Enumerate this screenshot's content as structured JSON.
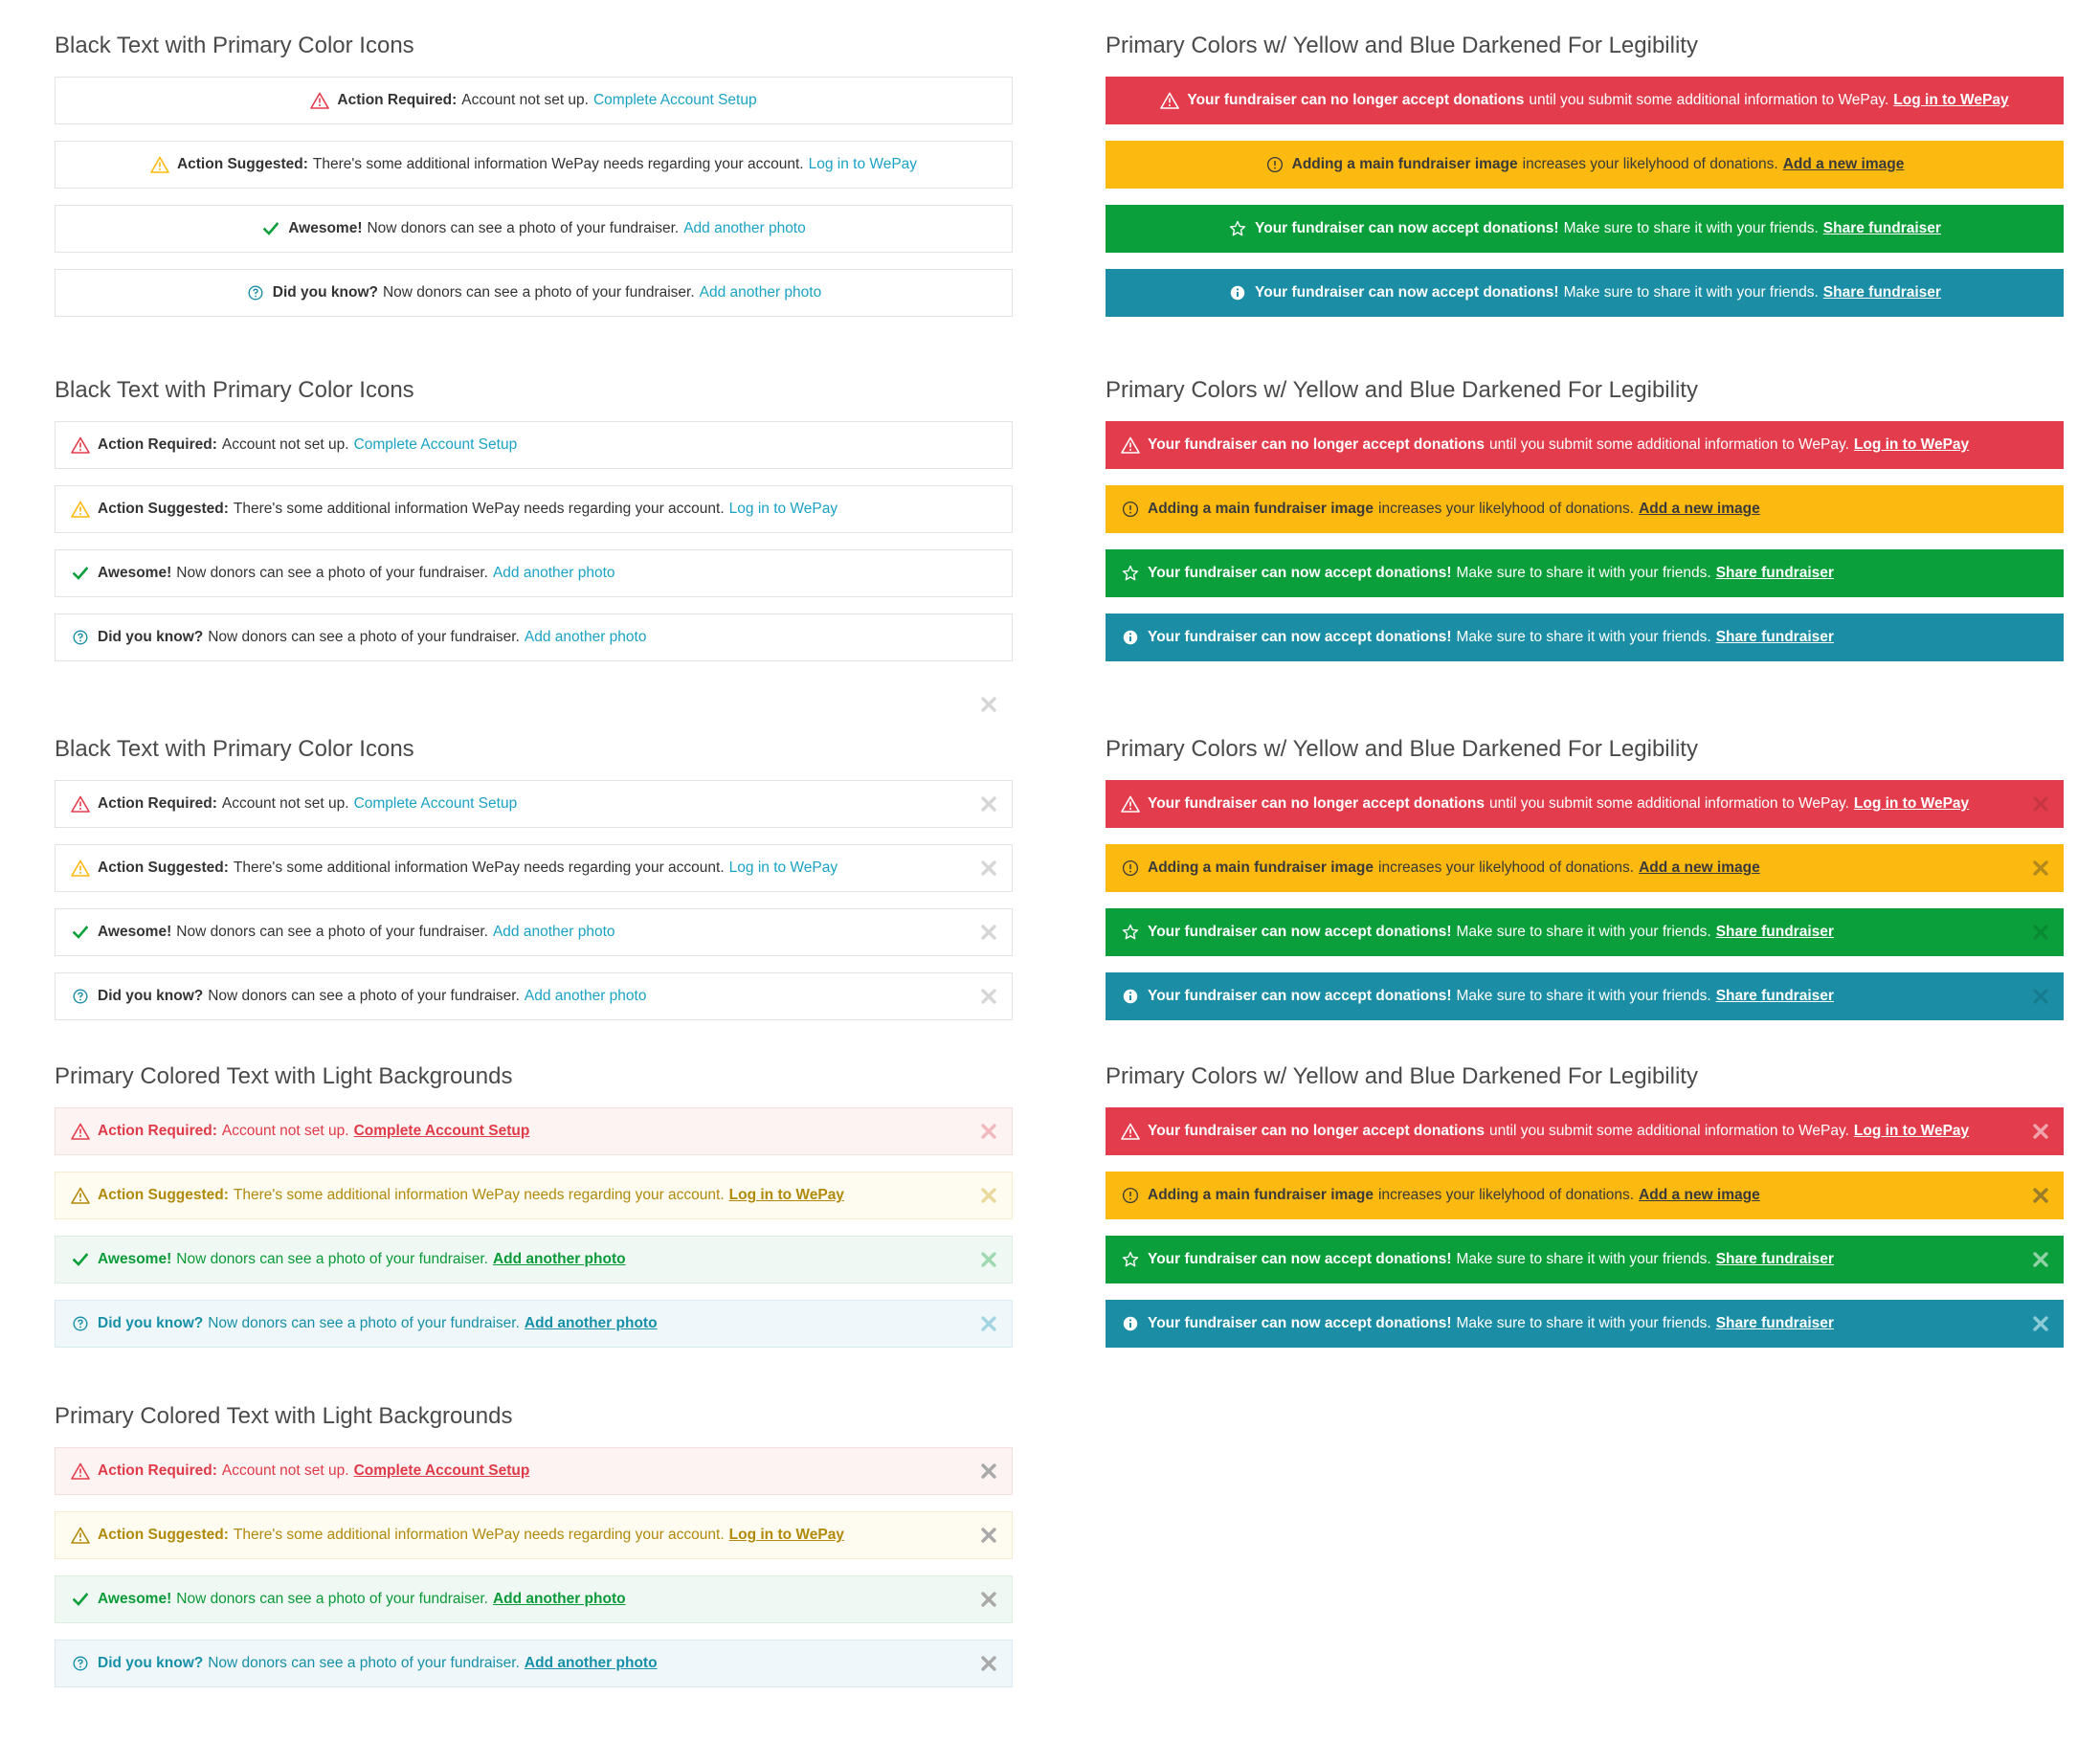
{
  "colors": {
    "red": "#e33d4d",
    "yellow": "#fcb90f",
    "green": "#0a9f3a",
    "blue": "#1b8ea6",
    "link": "#1aa3c4"
  },
  "left_sections": [
    {
      "title": "Black Text with Primary Color Icons",
      "alerts": [
        {
          "icon": "warning-triangle-icon",
          "bold": "Action Required:",
          "msg": "Account not set up.",
          "link": "Complete Account Setup"
        },
        {
          "icon": "warning-triangle-icon",
          "bold": "Action Suggested:",
          "msg": "There's some additional information WePay needs regarding your account.",
          "link": "Log in to WePay"
        },
        {
          "icon": "checkmark-icon",
          "bold": "Awesome!",
          "msg": "Now donors can see a photo of your fundraiser.",
          "link": "Add another photo"
        },
        {
          "icon": "question-circle-icon",
          "bold": "Did you know?",
          "msg": "Now donors can see a photo of your fundraiser.",
          "link": "Add another photo"
        }
      ]
    },
    {
      "title": "Black Text with Primary Color Icons",
      "alerts": [
        {
          "icon": "warning-triangle-icon",
          "bold": "Action Required:",
          "msg": "Account not set up.",
          "link": "Complete Account Setup"
        },
        {
          "icon": "warning-triangle-icon",
          "bold": "Action Suggested:",
          "msg": "There's some additional information WePay needs regarding your account.",
          "link": "Log in to WePay"
        },
        {
          "icon": "checkmark-icon",
          "bold": "Awesome!",
          "msg": "Now donors can see a photo of your fundraiser.",
          "link": "Add another photo"
        },
        {
          "icon": "question-circle-icon",
          "bold": "Did you know?",
          "msg": "Now donors can see a photo of your fundraiser.",
          "link": "Add another photo"
        }
      ]
    },
    {
      "title": "Black Text with Primary Color Icons",
      "alerts": [
        {
          "icon": "warning-triangle-icon",
          "bold": "Action Required:",
          "msg": "Account not set up.",
          "link": "Complete Account Setup"
        },
        {
          "icon": "warning-triangle-icon",
          "bold": "Action Suggested:",
          "msg": "There's some additional information WePay needs regarding your account.",
          "link": "Log in to WePay"
        },
        {
          "icon": "checkmark-icon",
          "bold": "Awesome!",
          "msg": "Now donors can see a photo of your fundraiser.",
          "link": "Add another photo"
        },
        {
          "icon": "question-circle-icon",
          "bold": "Did you know?",
          "msg": "Now donors can see a photo of your fundraiser.",
          "link": "Add another photo"
        }
      ]
    },
    {
      "title": "Primary Colored Text with Light Backgrounds",
      "alerts": [
        {
          "icon": "warning-triangle-icon",
          "bold": "Action Required:",
          "msg": "Account not set up.",
          "link": "Complete Account Setup"
        },
        {
          "icon": "warning-triangle-icon",
          "bold": "Action Suggested:",
          "msg": "There's some additional information WePay needs regarding your account.",
          "link": "Log in to WePay"
        },
        {
          "icon": "checkmark-icon",
          "bold": "Awesome!",
          "msg": "Now donors can see a photo of your fundraiser.",
          "link": "Add another photo"
        },
        {
          "icon": "question-circle-icon",
          "bold": "Did you know?",
          "msg": "Now donors can see a photo of your fundraiser.",
          "link": "Add another photo"
        }
      ]
    },
    {
      "title": "Primary Colored Text with Light Backgrounds",
      "alerts": [
        {
          "icon": "warning-triangle-icon",
          "bold": "Action Required:",
          "msg": "Account not set up.",
          "link": "Complete Account Setup"
        },
        {
          "icon": "warning-triangle-icon",
          "bold": "Action Suggested:",
          "msg": "There's some additional information WePay needs regarding your account.",
          "link": "Log in to WePay"
        },
        {
          "icon": "checkmark-icon",
          "bold": "Awesome!",
          "msg": "Now donors can see a photo of your fundraiser.",
          "link": "Add another photo"
        },
        {
          "icon": "question-circle-icon",
          "bold": "Did you know?",
          "msg": "Now donors can see a photo of your fundraiser.",
          "link": "Add another photo"
        }
      ]
    }
  ],
  "right_sections": [
    {
      "title": "Primary Colors w/ Yellow and Blue Darkened For Legibility",
      "alerts": [
        {
          "icon": "warning-triangle-icon",
          "bold": "Your fundraiser can no longer accept donations",
          "msg": "until you submit some additional information to WePay.",
          "link": "Log in to WePay"
        },
        {
          "icon": "info-outline-circle-icon",
          "bold": "Adding a main fundraiser image",
          "msg": "increases your likelyhood of donations.",
          "link": "Add a new image"
        },
        {
          "icon": "star-outline-icon",
          "bold": "Your fundraiser can now accept donations!",
          "msg": "Make sure to share it with your friends.",
          "link": "Share fundraiser"
        },
        {
          "icon": "info-solid-circle-icon",
          "bold": "Your fundraiser can now accept donations!",
          "msg": "Make sure to share it with your friends.",
          "link": "Share fundraiser"
        }
      ]
    },
    {
      "title": "Primary Colors w/ Yellow and Blue Darkened For Legibility",
      "alerts": [
        {
          "icon": "warning-triangle-icon",
          "bold": "Your fundraiser can no longer accept donations",
          "msg": "until you submit some additional information to WePay.",
          "link": "Log in to WePay"
        },
        {
          "icon": "info-outline-circle-icon",
          "bold": "Adding a main fundraiser image",
          "msg": "increases your likelyhood of donations.",
          "link": "Add a new image"
        },
        {
          "icon": "star-outline-icon",
          "bold": "Your fundraiser can now accept donations!",
          "msg": "Make sure to share it with your friends.",
          "link": "Share fundraiser"
        },
        {
          "icon": "info-solid-circle-icon",
          "bold": "Your fundraiser can now accept donations!",
          "msg": "Make sure to share it with your friends.",
          "link": "Share fundraiser"
        }
      ]
    },
    {
      "title": "Primary Colors w/ Yellow and Blue Darkened For Legibility",
      "alerts": [
        {
          "icon": "warning-triangle-icon",
          "bold": "Your fundraiser can no longer accept donations",
          "msg": "until you submit some additional information to WePay.",
          "link": "Log in to WePay"
        },
        {
          "icon": "info-outline-circle-icon",
          "bold": "Adding a main fundraiser image",
          "msg": "increases your likelyhood of donations.",
          "link": "Add a new image"
        },
        {
          "icon": "star-outline-icon",
          "bold": "Your fundraiser can now accept donations!",
          "msg": "Make sure to share it with your friends.",
          "link": "Share fundraiser"
        },
        {
          "icon": "info-solid-circle-icon",
          "bold": "Your fundraiser can now accept donations!",
          "msg": "Make sure to share it with your friends.",
          "link": "Share fundraiser"
        }
      ]
    },
    {
      "title": "Primary Colors w/ Yellow and Blue Darkened For Legibility",
      "alerts": [
        {
          "icon": "warning-triangle-icon",
          "bold": "Your fundraiser can no longer accept donations",
          "msg": "until you submit some additional information to WePay.",
          "link": "Log in to WePay"
        },
        {
          "icon": "info-outline-circle-icon",
          "bold": "Adding a main fundraiser image",
          "msg": "increases your likelyhood of donations.",
          "link": "Add a new image"
        },
        {
          "icon": "star-outline-icon",
          "bold": "Your fundraiser can now accept donations!",
          "msg": "Make sure to share it with your friends.",
          "link": "Share fundraiser"
        },
        {
          "icon": "info-solid-circle-icon",
          "bold": "Your fundraiser can now accept donations!",
          "msg": "Make sure to share it with your friends.",
          "link": "Share fundraiser"
        }
      ]
    }
  ]
}
